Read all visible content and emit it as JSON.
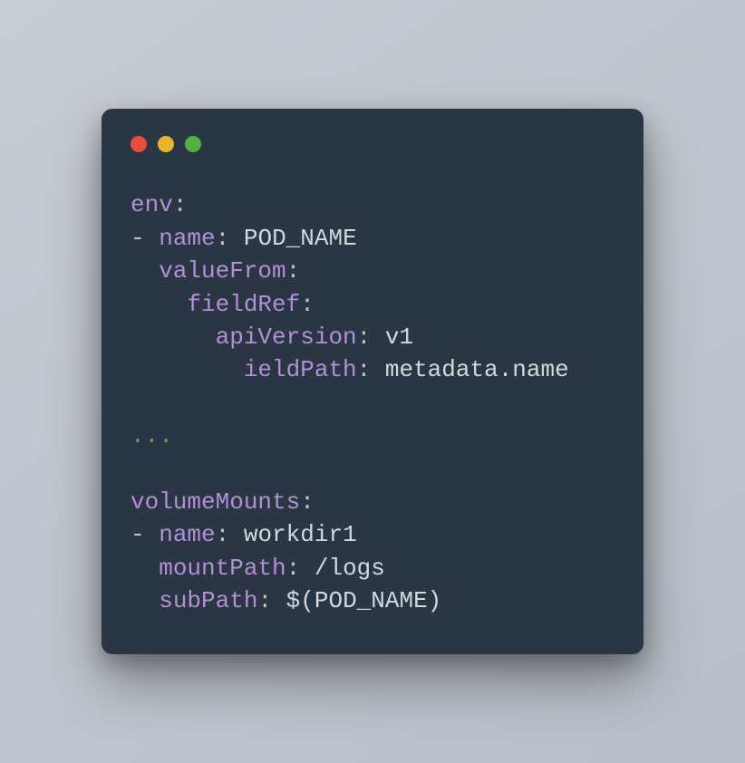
{
  "code": {
    "line1": {
      "key": "env",
      "colon": ":"
    },
    "line2": {
      "dash": "- ",
      "key": "name",
      "colon": ": ",
      "value": "POD_NAME"
    },
    "line3": {
      "indent": "  ",
      "key": "valueFrom",
      "colon": ":"
    },
    "line4": {
      "indent": "    ",
      "key": "fieldRef",
      "colon": ":"
    },
    "line5": {
      "indent": "      ",
      "key": "apiVersion",
      "colon": ": ",
      "value": "v1"
    },
    "line6": {
      "indent": "        ",
      "key": "ieldPath",
      "colon": ": ",
      "value": "metadata.name"
    },
    "line7": {
      "blank": ""
    },
    "line8": {
      "ellipsis": "..."
    },
    "line9": {
      "blank": ""
    },
    "line10": {
      "key": "volumeMounts",
      "colon": ":"
    },
    "line11": {
      "dash": "- ",
      "key": "name",
      "colon": ": ",
      "value": "workdir1"
    },
    "line12": {
      "indent": "  ",
      "key": "mountPath",
      "colon": ": ",
      "value": "/logs"
    },
    "line13": {
      "indent": "  ",
      "key": "subPath",
      "colon": ": ",
      "value": "$(POD_NAME)"
    }
  }
}
